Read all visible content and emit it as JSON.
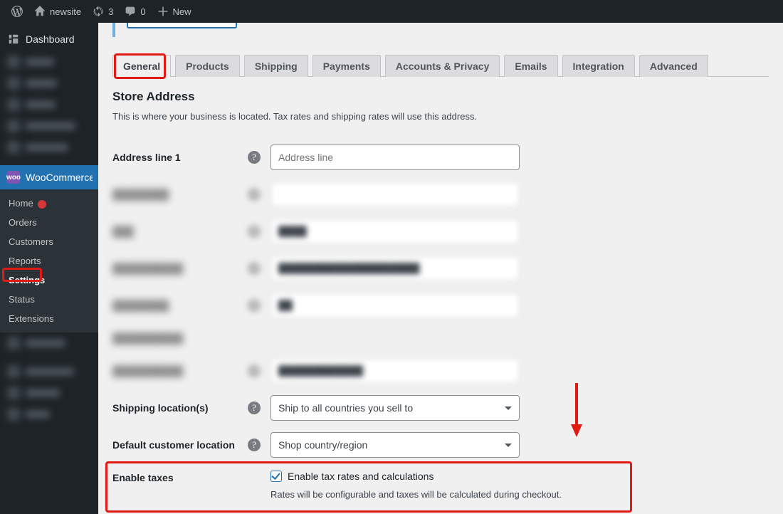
{
  "adminbar": {
    "site_name": "newsite",
    "updates_count": "3",
    "comments_count": "0",
    "new_label": "New"
  },
  "sidebar": {
    "dashboard_label": "Dashboard",
    "woo_label": "WooCommerce",
    "woo_badge": "woo",
    "submenu": {
      "home": "Home",
      "orders": "Orders",
      "customers": "Customers",
      "reports": "Reports",
      "settings": "Settings",
      "status": "Status",
      "extensions": "Extensions"
    }
  },
  "tabs": [
    {
      "id": "general",
      "label": "General",
      "active": true
    },
    {
      "id": "products",
      "label": "Products"
    },
    {
      "id": "shipping",
      "label": "Shipping"
    },
    {
      "id": "payments",
      "label": "Payments"
    },
    {
      "id": "accounts",
      "label": "Accounts & Privacy"
    },
    {
      "id": "emails",
      "label": "Emails"
    },
    {
      "id": "integration",
      "label": "Integration"
    },
    {
      "id": "advanced",
      "label": "Advanced"
    }
  ],
  "store_address": {
    "heading": "Store Address",
    "description": "This is where your business is located. Tax rates and shipping rates will use this address.",
    "address1_label": "Address line 1",
    "address1_placeholder": "Address line"
  },
  "shipping_locations": {
    "label": "Shipping location(s)",
    "value": "Ship to all countries you sell to"
  },
  "default_customer_location": {
    "label": "Default customer location",
    "value": "Shop country/region"
  },
  "enable_taxes": {
    "label": "Enable taxes",
    "checkbox_label": "Enable tax rates and calculations",
    "helper": "Rates will be configurable and taxes will be calculated during checkout.",
    "checked": true
  },
  "help_icon_text": "?"
}
